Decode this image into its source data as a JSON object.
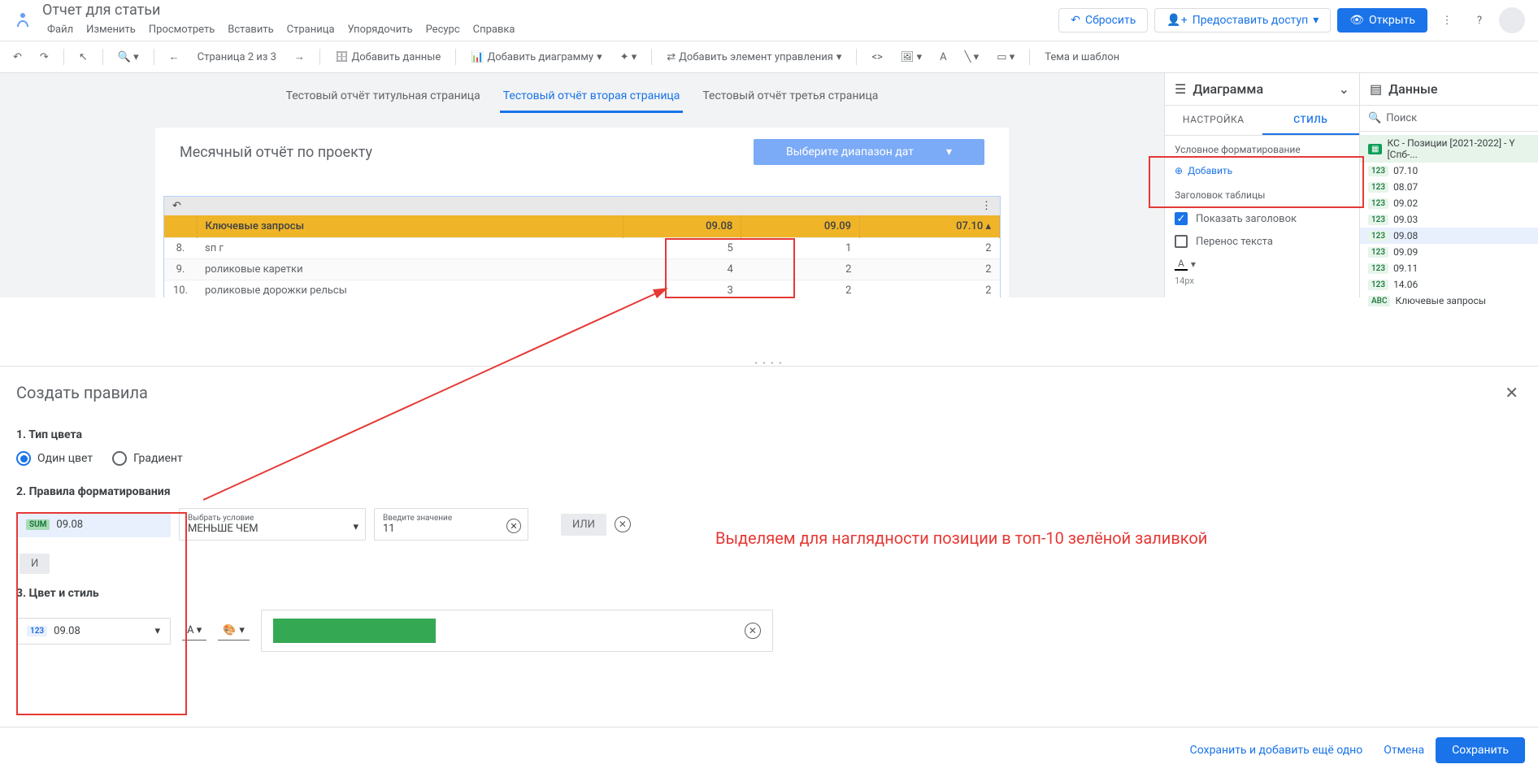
{
  "header": {
    "doc_title": "Отчет для статьи",
    "menu": {
      "file": "Файл",
      "edit": "Изменить",
      "view": "Просмотреть",
      "insert": "Вставить",
      "page": "Страница",
      "arrange": "Упорядочить",
      "resource": "Ресурс",
      "help": "Справка"
    },
    "reset": "Сбросить",
    "share": "Предоставить доступ",
    "open": "Открыть"
  },
  "toolbar": {
    "page_indicator": "Страница 2 из 3",
    "add_data": "Добавить данные",
    "add_chart": "Добавить диаграмму",
    "add_control": "Добавить элемент управления",
    "theme": "Тема и шаблон"
  },
  "tabs": {
    "t1": "Тестовый отчёт титульная страница",
    "t2": "Тестовый отчёт вторая страница",
    "t3": "Тестовый отчёт третья страница"
  },
  "canvas": {
    "title": "Месячный отчёт по проекту",
    "date_range": "Выберите диапазон дат"
  },
  "table": {
    "headers": {
      "queries": "Ключевые запросы",
      "c1": "09.08",
      "c2": "09.09",
      "c3": "07.10"
    },
    "rows": [
      {
        "idx": "8.",
        "q": "sп г",
        "v1": "5",
        "v2": "1",
        "v3": "2"
      },
      {
        "idx": "9.",
        "q": "роликовые каретки",
        "v1": "4",
        "v2": "2",
        "v3": "2"
      },
      {
        "idx": "10.",
        "q": "роликовые дорожки рельсы",
        "v1": "3",
        "v2": "2",
        "v3": "2"
      }
    ]
  },
  "chart_panel": {
    "title": "Диаграмма",
    "tabs": {
      "setup": "НАСТРОЙКА",
      "style": "СТИЛЬ"
    },
    "cond_format": "Условное форматирование",
    "add": "Добавить",
    "table_header": "Заголовок таблицы",
    "show_header": "Показать заголовок",
    "wrap_text": "Перенос текста",
    "font_size": "14px"
  },
  "data_panel": {
    "title": "Данные",
    "search": "Поиск",
    "source": "КС - Позиции [2021-2022] - Y [Спб-...",
    "items": [
      "07.10",
      "08.07",
      "09.02",
      "09.03",
      "09.08",
      "09.09",
      "09.11",
      "14.06"
    ],
    "key_queries": "Ключевые запросы"
  },
  "rules": {
    "title": "Создать правила",
    "step1": "1. Тип цвета",
    "single": "Один цвет",
    "gradient": "Градиент",
    "step2": "2. Правила форматирования",
    "field": "09.08",
    "field_badge": "SUM",
    "condition_label": "Выбрать условие",
    "condition_value": "МЕНЬШЕ ЧЕМ",
    "value_label": "Введите значение",
    "value": "11",
    "or": "ИЛИ",
    "and": "И",
    "step3": "3. Цвет и стиль",
    "field2": "09.08",
    "field2_badge": "123",
    "footer_save_more": "Сохранить и добавить ещё одно",
    "footer_cancel": "Отмена",
    "footer_save": "Сохранить"
  },
  "annotation": {
    "text": "Выделяем для наглядности позиции в топ-10 зелёной заливкой"
  }
}
